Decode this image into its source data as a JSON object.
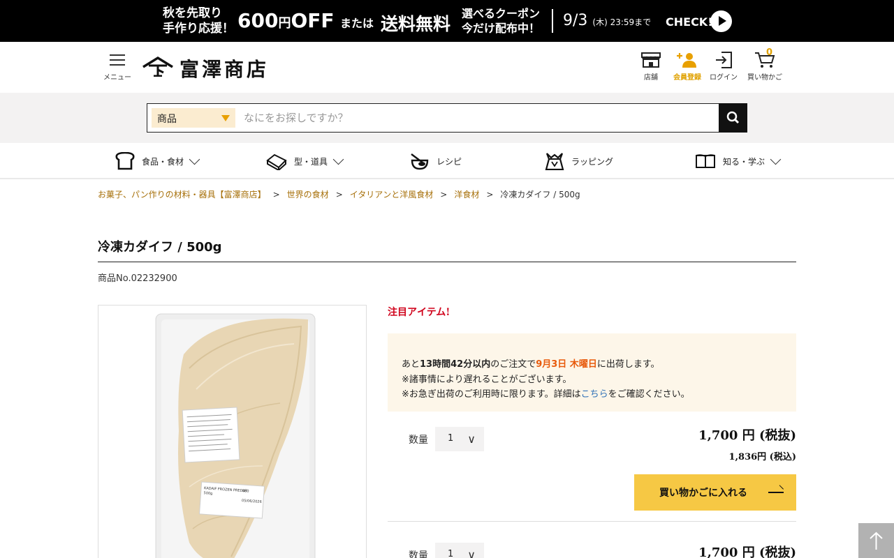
{
  "banner": {
    "left_line1": "秋を先取り",
    "left_line2": "手作り応援！",
    "amount": "600",
    "yen_off_small": "円",
    "off": "OFF",
    "or_text": "または",
    "free_shipping": "送料無料",
    "coupon_line1": "選べるクーポン",
    "coupon_line2": "今だけ配布中！",
    "date": "9/3",
    "date_suffix": "(木) 23:59まで",
    "check": "CHECK!"
  },
  "header": {
    "menu_label": "メニュー",
    "logo_text": "富澤商店",
    "icons": {
      "store": "店舗",
      "register": "会員登録",
      "login": "ログイン",
      "cart": "買い物かご",
      "cart_count": "0"
    }
  },
  "search": {
    "category": "商品",
    "placeholder": "なにをお探しですか？"
  },
  "categories": [
    {
      "label": "食品・食材"
    },
    {
      "label": "型・道具"
    },
    {
      "label": "レシピ"
    },
    {
      "label": "ラッピング"
    },
    {
      "label": "知る・学ぶ"
    }
  ],
  "breadcrumb": {
    "items": [
      "お菓子、パン作りの材料・器具【富澤商店】",
      "世界の食材",
      "イタリアンと洋風食材",
      "洋食材"
    ],
    "separator": ">",
    "current": "冷凍カダイフ / 500g"
  },
  "product": {
    "title": "冷凍カダイフ / 500g",
    "number": "商品No.02232900",
    "featured": "注目アイテム!",
    "shipping": {
      "pre": "あと",
      "time": "13時間42分以内",
      "mid": "のご注文で",
      "date": "9月3日 木曜日",
      "post": "に出荷します。",
      "note1": "※諸事情により遅れることがございます。",
      "note2_pre": "※お急ぎ出荷のご利用時に限ります。詳細は",
      "note2_link": "こちら",
      "note2_post": "をご確認ください。"
    },
    "purchase_rows": [
      {
        "qty_label": "数量",
        "qty": "1",
        "price": "1,700 円 (税抜)",
        "price_tax": "1,836円 (税込)",
        "cart_button": "買い物かごに入れる"
      },
      {
        "qty_label": "数量",
        "qty": "1",
        "price": "1,700 円 (税抜)"
      }
    ],
    "package_label_lines": [
      "KADAIF FROZEN PREDUT",
      "500g",
      "880",
      "05/06/2026"
    ]
  },
  "colors": {
    "accent": "#f6c844",
    "brand_gold": "#a7700a",
    "featured_red": "#d0021b",
    "highlight_orange": "#e85a0c"
  }
}
